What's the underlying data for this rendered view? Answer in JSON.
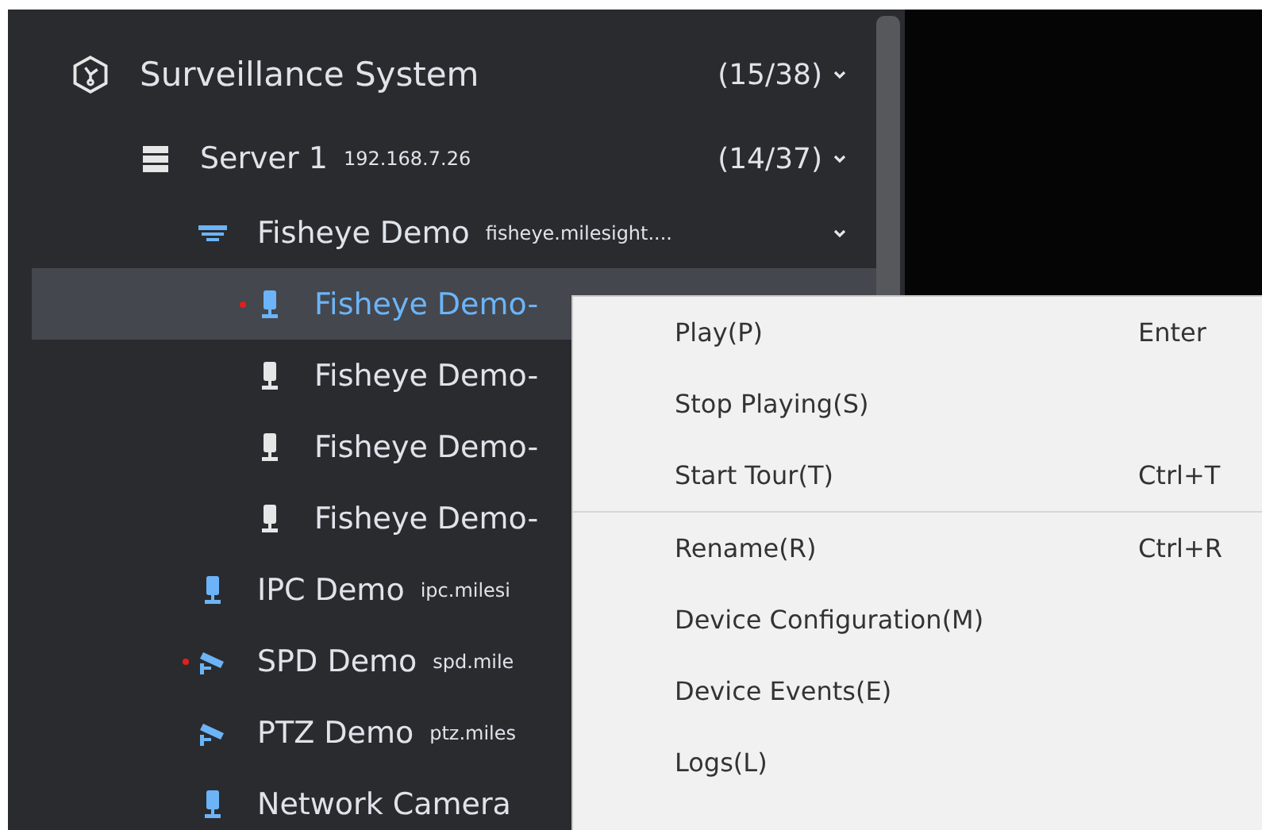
{
  "tree": {
    "kind": "system",
    "label": "Surveillance System",
    "count": "(15/38)",
    "expanded": true,
    "children": [
      {
        "kind": "server",
        "label": "Server 1",
        "address": "192.168.7.26",
        "count": "(14/37)",
        "expanded": true,
        "children": [
          {
            "kind": "fisheye",
            "label": "Fisheye Demo",
            "address": "fisheye.milesight....",
            "expanded": true,
            "children": [
              {
                "kind": "channel",
                "label": "Fisheye Demo-",
                "selected": true,
                "alarm": true
              },
              {
                "kind": "channel",
                "label": "Fisheye Demo-",
                "selected": false,
                "alarm": false
              },
              {
                "kind": "channel",
                "label": "Fisheye Demo-",
                "selected": false,
                "alarm": false
              },
              {
                "kind": "channel",
                "label": "Fisheye Demo-",
                "selected": false,
                "alarm": false
              }
            ]
          },
          {
            "kind": "bullet",
            "label": "IPC Demo",
            "address": "ipc.milesi",
            "alarm": false
          },
          {
            "kind": "ptz",
            "label": "SPD Demo",
            "address": "spd.mile",
            "alarm": true
          },
          {
            "kind": "ptz",
            "label": "PTZ Demo",
            "address": "ptz.miles",
            "alarm": false
          },
          {
            "kind": "bullet",
            "label": "Network Camera",
            "alarm": false
          }
        ]
      }
    ]
  },
  "context_menu": {
    "groups": [
      [
        {
          "label": "Play(P)",
          "shortcut": "Enter"
        },
        {
          "label": "Stop Playing(S)"
        },
        {
          "label": "Start Tour(T)",
          "shortcut": "Ctrl+T"
        }
      ],
      [
        {
          "label": "Rename(R)",
          "shortcut": "Ctrl+R"
        },
        {
          "label": "Device Configuration(M)"
        },
        {
          "label": "Device Events(E)"
        },
        {
          "label": "Logs(L)"
        }
      ]
    ]
  }
}
